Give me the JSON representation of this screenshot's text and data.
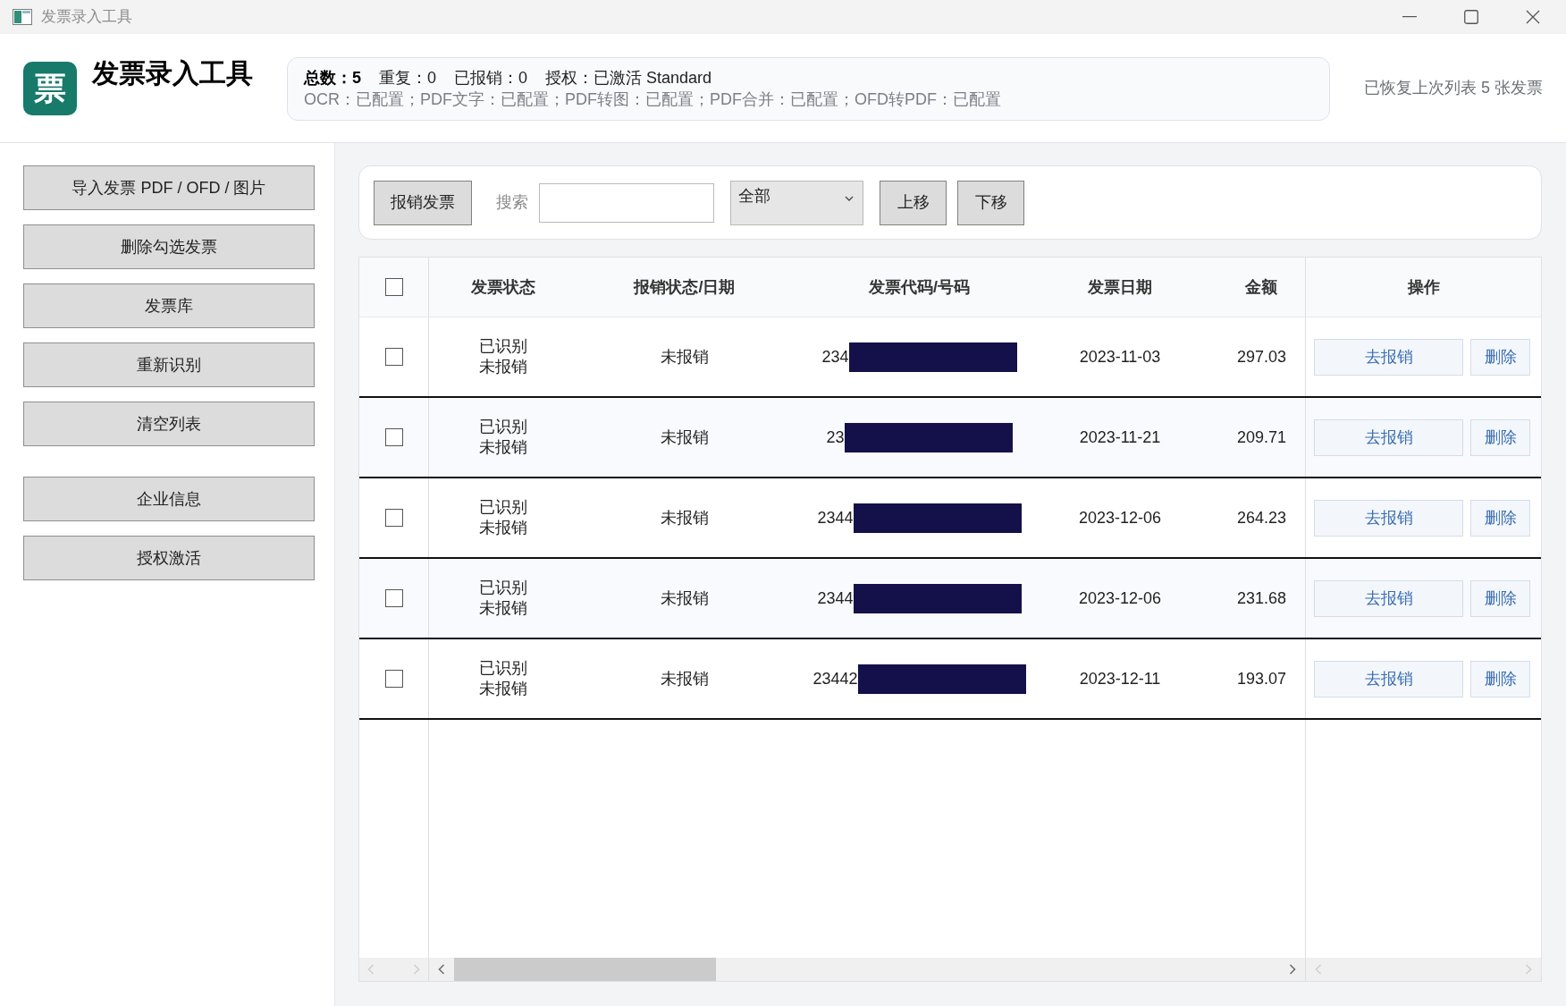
{
  "window": {
    "title": "发票录入工具"
  },
  "header": {
    "logo_text": "票",
    "title": "发票录入工具",
    "summary": [
      {
        "text": "总数：5",
        "emphasis": true
      },
      {
        "text": "重复：0",
        "emphasis": false
      },
      {
        "text": "已报销：0",
        "emphasis": false
      },
      {
        "text": "授权：已激活 Standard",
        "emphasis": false
      }
    ],
    "capabilities": "OCR：已配置；PDF文字：已配置；PDF转图：已配置；PDF合并：已配置；OFD转PDF：已配置",
    "restore_message": "已恢复上次列表 5 张发票"
  },
  "sidebar": {
    "groups": [
      {
        "buttons": [
          "导入发票 PDF / OFD / 图片",
          "删除勾选发票",
          "发票库",
          "重新识别",
          "清空列表"
        ]
      },
      {
        "buttons": [
          "企业信息",
          "授权激活"
        ]
      }
    ]
  },
  "toolbar": {
    "reimburse_button": "报销发票",
    "search": {
      "label": "搜索"
    },
    "filter": {
      "value": "全部"
    },
    "move_up_button": "上移",
    "move_down_button": "下移"
  },
  "table": {
    "select_all": {
      "checked": false
    },
    "columns": [
      "发票状态",
      "报销状态/日期",
      "发票代码/号码",
      "发票日期",
      "金额",
      "操作"
    ],
    "rows": [
      {
        "checked": false,
        "invoice_status": [
          "已识别",
          "未报销"
        ],
        "reimbursement": "未报销",
        "code": "234",
        "date": "2023-11-03",
        "amount": "297.03",
        "actions": [
          "去报销",
          "删除"
        ]
      },
      {
        "checked": false,
        "invoice_status": [
          "已识别",
          "未报销"
        ],
        "reimbursement": "未报销",
        "code": "23",
        "date": "2023-11-21",
        "amount": "209.71",
        "actions": [
          "去报销",
          "删除"
        ]
      },
      {
        "checked": false,
        "invoice_status": [
          "已识别",
          "未报销"
        ],
        "reimbursement": "未报销",
        "code": "2344",
        "date": "2023-12-06",
        "amount": "264.23",
        "actions": [
          "去报销",
          "删除"
        ]
      },
      {
        "checked": false,
        "invoice_status": [
          "已识别",
          "未报销"
        ],
        "reimbursement": "未报销",
        "code": "2344",
        "date": "2023-12-06",
        "amount": "231.68",
        "actions": [
          "去报销",
          "删除"
        ]
      },
      {
        "checked": false,
        "invoice_status": [
          "已识别",
          "未报销"
        ],
        "reimbursement": "未报销",
        "code": "23442",
        "date": "2023-12-11",
        "amount": "193.07",
        "actions": [
          "去报销",
          "删除"
        ]
      }
    ]
  }
}
